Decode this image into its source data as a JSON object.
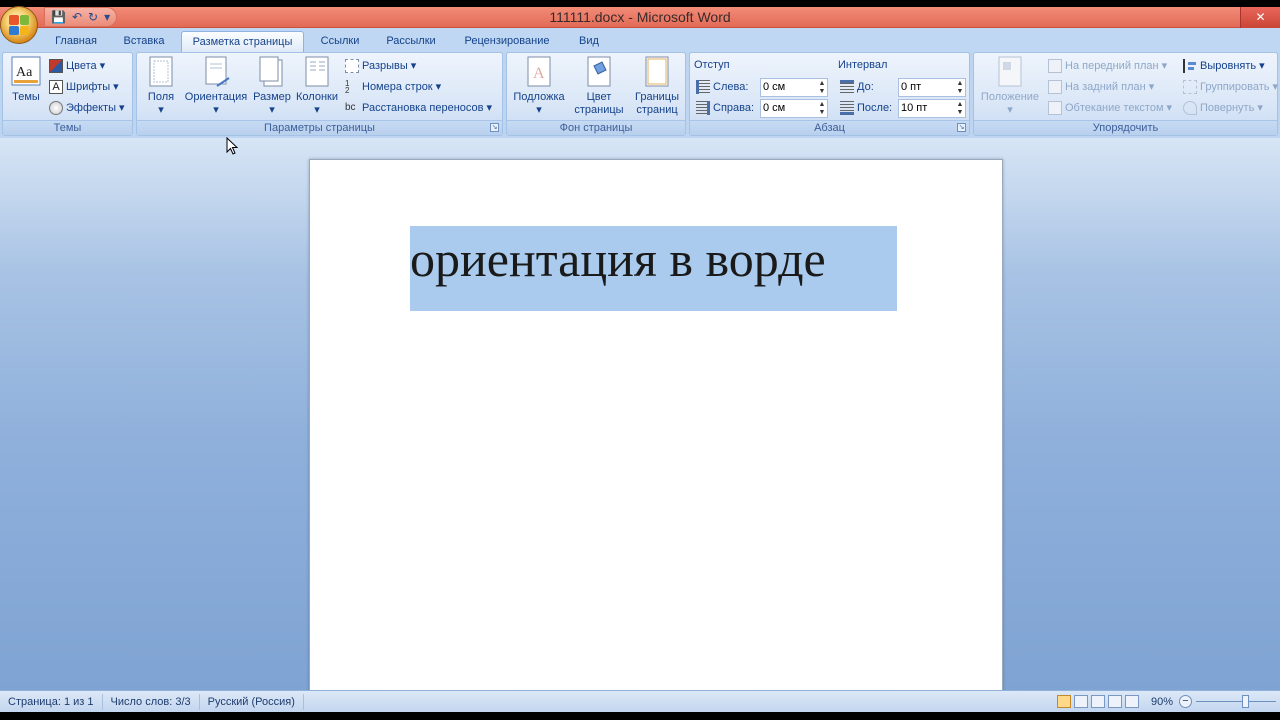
{
  "window": {
    "title": "111111.docx - Microsoft Word"
  },
  "qat": {
    "save": "💾",
    "undo": "↶",
    "redo": "↻",
    "customize": "▾"
  },
  "tabs": [
    {
      "label": "Главная"
    },
    {
      "label": "Вставка"
    },
    {
      "label": "Разметка страницы"
    },
    {
      "label": "Ссылки"
    },
    {
      "label": "Рассылки"
    },
    {
      "label": "Рецензирование"
    },
    {
      "label": "Вид"
    }
  ],
  "ribbon": {
    "themes": {
      "label": "Темы",
      "themes_btn": "Темы",
      "colors": "Цвета",
      "fonts": "Шрифты",
      "effects": "Эффекты"
    },
    "page_setup": {
      "label": "Параметры страницы",
      "margins": "Поля",
      "orientation": "Ориентация",
      "size": "Размер",
      "columns": "Колонки",
      "breaks": "Разрывы",
      "line_numbers": "Номера строк",
      "hyphenation": "Расстановка переносов"
    },
    "page_background": {
      "label": "Фон страницы",
      "watermark": "Подложка",
      "page_color_1": "Цвет",
      "page_color_2": "страницы",
      "page_borders_1": "Границы",
      "page_borders_2": "страниц"
    },
    "paragraph": {
      "label": "Абзац",
      "indent_title": "Отступ",
      "left_label": "Слева:",
      "left_value": "0 см",
      "right_label": "Справа:",
      "right_value": "0 см",
      "spacing_title": "Интервал",
      "before_label": "До:",
      "before_value": "0 пт",
      "after_label": "После:",
      "after_value": "10 пт"
    },
    "arrange": {
      "label": "Упорядочить",
      "position": "Положение",
      "bring_front": "На передний план",
      "send_back": "На задний план",
      "wrap_text": "Обтекание текстом",
      "align": "Выровнять",
      "group": "Группировать",
      "rotate": "Повернуть"
    }
  },
  "document": {
    "text": "ориентация в ворде"
  },
  "status": {
    "page": "Страница: 1 из 1",
    "words": "Число слов: 3/3",
    "language": "Русский (Россия)",
    "zoom": "90%"
  },
  "colors": {
    "titlebar": "#e26a56",
    "selection": "#aacbee",
    "ribbon": "#dbe7f7"
  }
}
